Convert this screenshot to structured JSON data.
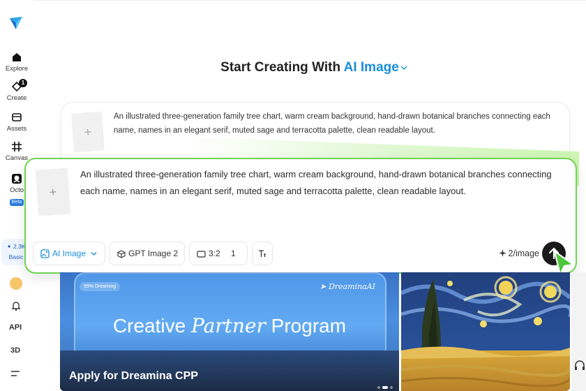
{
  "sidebar": {
    "items": [
      {
        "label": "Explore",
        "icon": "home-icon"
      },
      {
        "label": "Create",
        "icon": "create-icon",
        "badge": "1"
      },
      {
        "label": "Assets",
        "icon": "folder-icon"
      },
      {
        "label": "Canvas",
        "icon": "canvas-icon"
      },
      {
        "label": "Octo",
        "icon": "octo-icon",
        "tag": "Beta"
      }
    ],
    "credits": {
      "value": "✦ 2.3K",
      "plan": "Basic"
    },
    "api_label": "API",
    "three_d_label": "3D"
  },
  "heading": {
    "prefix": "Start Creating With",
    "mode": "AI Image"
  },
  "prompt": {
    "text": "An illustrated three-generation family tree chart, warm cream background, hand-drawn botanical branches connecting each name, names in an elegant serif, muted sage and terracotta palette, clean readable layout.",
    "thumb_symbol": "+"
  },
  "toolbar": {
    "mode_label": "AI Image",
    "model_label": "GPT Image 2",
    "ratio_label": "3:2",
    "count_label": "1",
    "cost_label": "2/image"
  },
  "banner": {
    "pill": "99% Dreaming",
    "brand": "DreaminaAI",
    "title_pre": "Creative",
    "title_script": "Partner",
    "title_post": "Program",
    "cta": "Apply for Dreamina CPP"
  },
  "colors": {
    "accent": "#1a8fd6",
    "card_border": "#6fd453",
    "send_button": "#1a1a1a",
    "cursor": "#4cc63a"
  }
}
